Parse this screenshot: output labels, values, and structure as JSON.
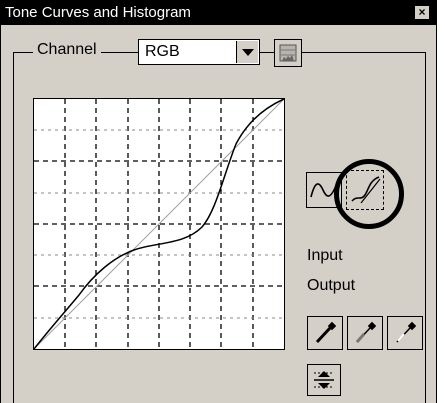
{
  "window": {
    "title": "Tone Curves and Histogram",
    "close_label": "×"
  },
  "channel": {
    "label": "Channel",
    "selected": "RGB"
  },
  "readouts": {
    "input_label": "Input",
    "output_label": "Output"
  },
  "icons": {
    "histogram_toggle": "histogram-icon",
    "smooth_curve": "smooth-curve-icon",
    "freehand_curve": "freehand-curve-icon",
    "black_point": "black-eyedropper-icon",
    "gray_point": "gray-eyedropper-icon",
    "white_point": "white-eyedropper-icon",
    "reset": "reset-levels-icon"
  },
  "colors": {
    "dialog_bg": "#d4d0c8",
    "titlebar_bg": "#000000",
    "titlebar_text": "#ffffff",
    "curve": "#000000",
    "diagonal": "#a0a0a0"
  }
}
